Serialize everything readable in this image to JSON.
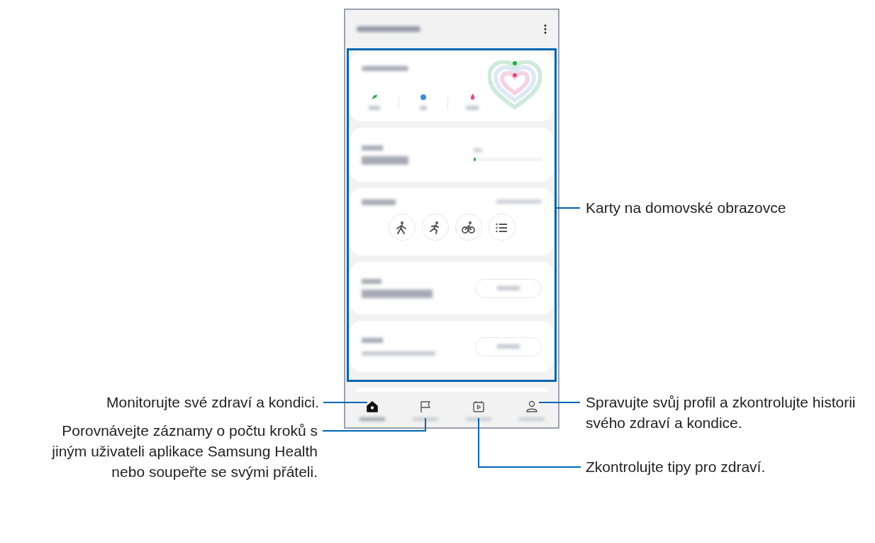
{
  "steps_progress": {
    "level": 0.03
  },
  "exercise_buttons": [
    {
      "kind": "walk"
    },
    {
      "kind": "run"
    },
    {
      "kind": "cycle"
    },
    {
      "kind": "list"
    }
  ],
  "nav": [
    {
      "kind": "home",
      "selected": true
    },
    {
      "kind": "flag",
      "selected": false
    },
    {
      "kind": "calendar",
      "selected": false
    },
    {
      "kind": "person",
      "selected": false
    }
  ],
  "callouts": [
    {
      "text": "Karty na domovské obrazovce"
    },
    {
      "text": "Monitorujte své zdraví a kondici."
    },
    {
      "text": "Spravujte svůj profil a zkontrolujte historii svého zdraví a kondice."
    },
    {
      "text": "Porovnávejte záznamy o počtu kroků s jiným uživateli aplikace Samsung Health nebo soupeřte se svými přáteli."
    },
    {
      "text": "Zkontrolujte tipy pro zdraví."
    }
  ]
}
